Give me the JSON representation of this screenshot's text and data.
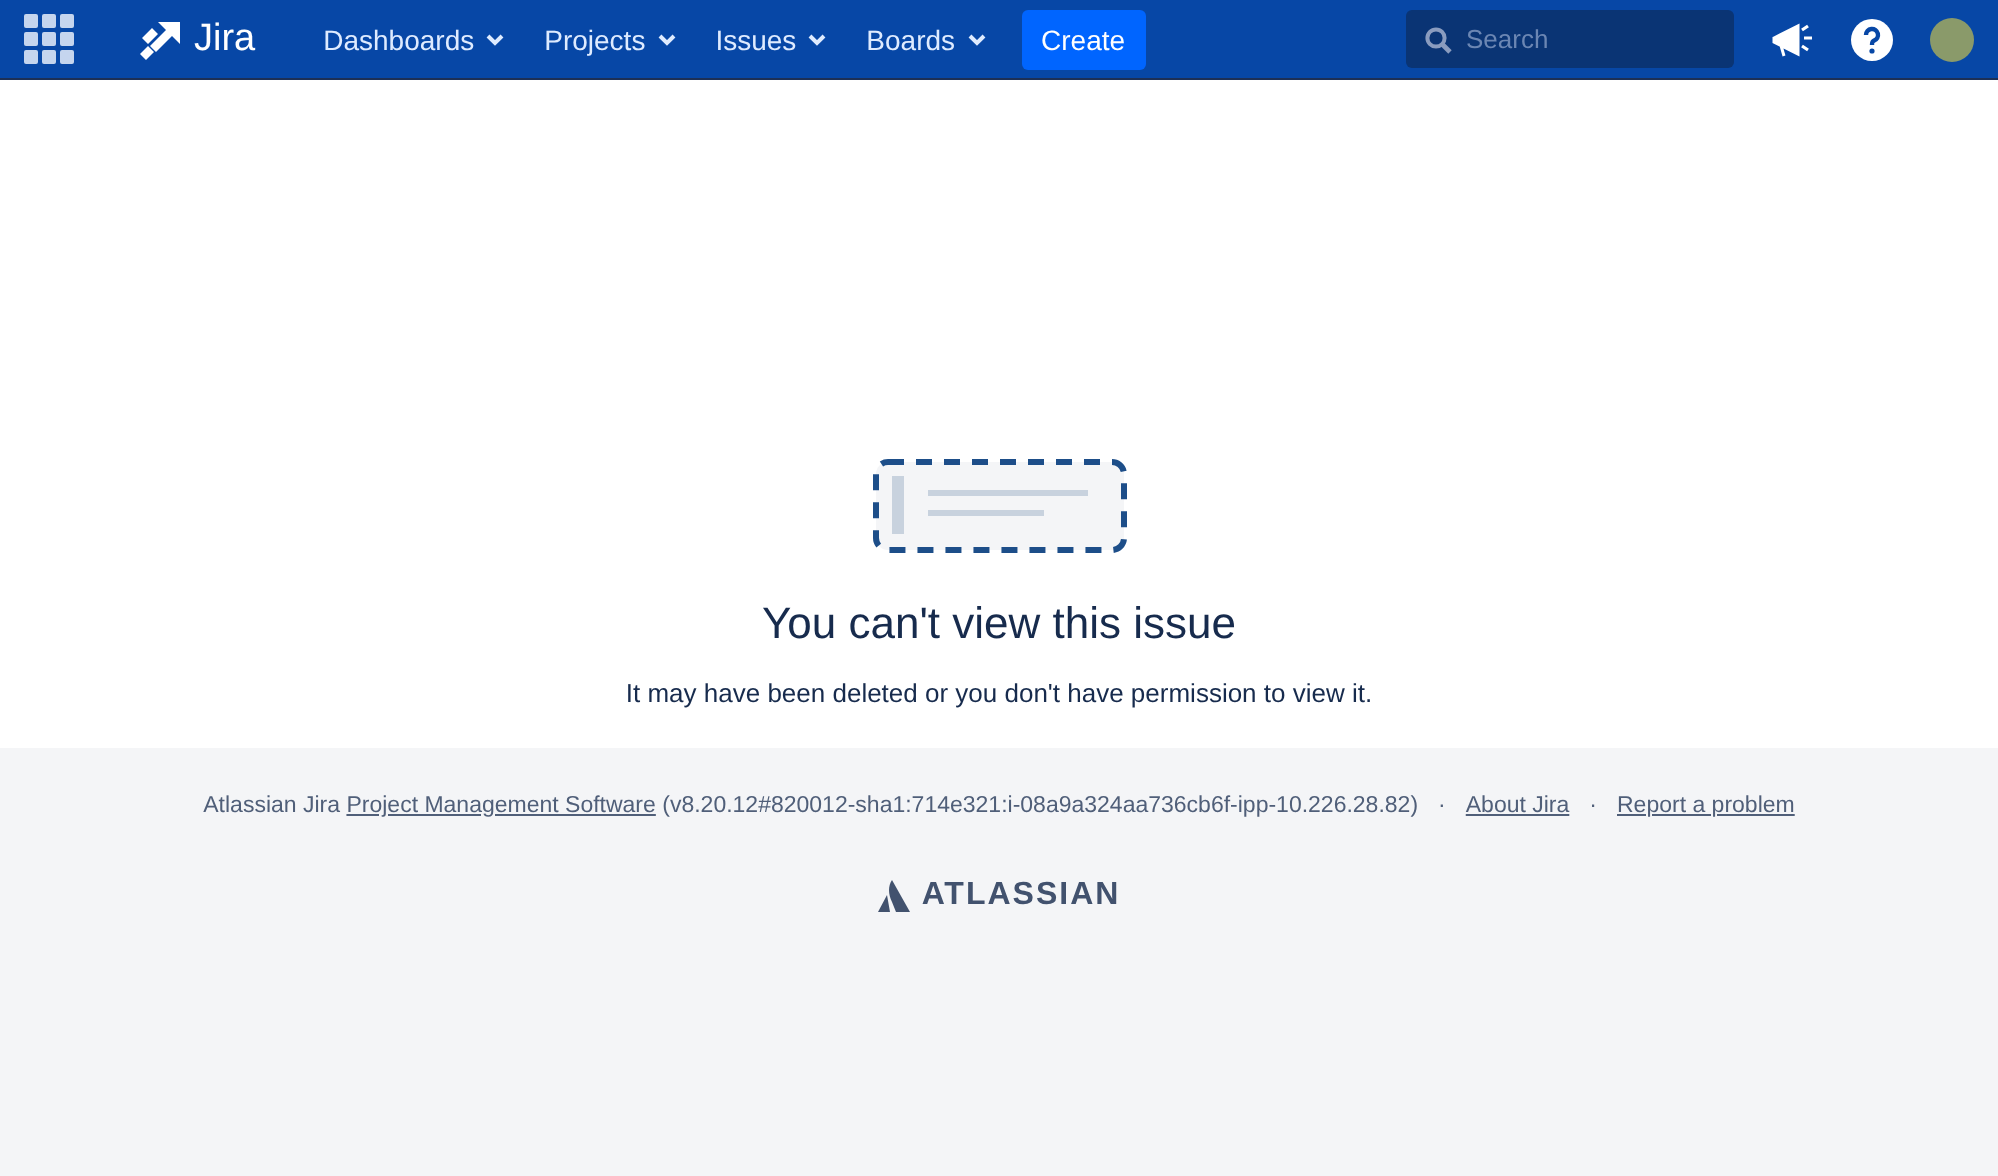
{
  "header": {
    "product": "Jira",
    "nav": [
      {
        "label": "Dashboards"
      },
      {
        "label": "Projects"
      },
      {
        "label": "Issues"
      },
      {
        "label": "Boards"
      }
    ],
    "create": "Create",
    "search": {
      "placeholder": "Search"
    }
  },
  "message": {
    "title": "You can't view this issue",
    "body": "It may have been deleted or you don't have permission to view it."
  },
  "footer": {
    "credit": {
      "prefix": "Atlassian Jira",
      "link": "Project Management Software",
      "suffix": "(v8.20.12#820012-sha1:714e321:i-08a9a324aa736cb6f-ipp-10.226.28.82)"
    },
    "separator": "·",
    "links": [
      "About Jira",
      "Report a problem"
    ],
    "brand": "ATLASSIAN"
  }
}
